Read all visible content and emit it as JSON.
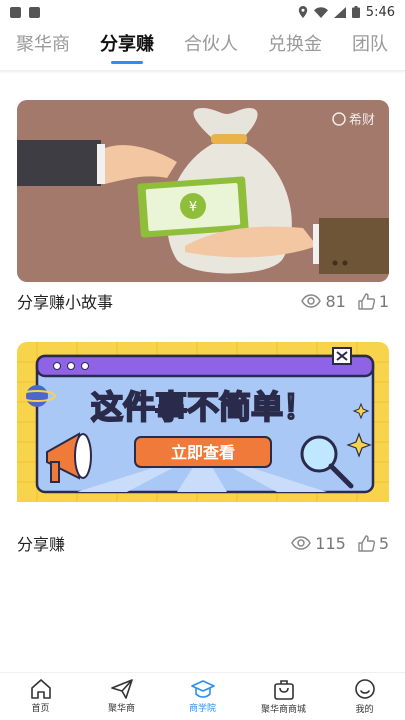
{
  "status_bar": {
    "time": "5:46"
  },
  "tabs": [
    {
      "label": "聚华商"
    },
    {
      "label": "分享赚"
    },
    {
      "label": "合伙人"
    },
    {
      "label": "兑换金"
    },
    {
      "label": "团队"
    }
  ],
  "active_tab": "分享赚",
  "cards": [
    {
      "title": "分享赚小故事",
      "views": "81",
      "likes": "1",
      "image_watermark": "希财"
    },
    {
      "title": "分享赚",
      "views": "115",
      "likes": "5",
      "banner_headline": "这件事不简单！",
      "banner_button": "立即查看"
    }
  ],
  "bottom_nav": [
    {
      "label": "首页",
      "icon": "home-icon"
    },
    {
      "label": "聚华商",
      "icon": "paper-plane-icon"
    },
    {
      "label": "商学院",
      "icon": "graduation-cap-icon"
    },
    {
      "label": "聚华商商城",
      "icon": "shopping-bag-icon"
    },
    {
      "label": "我的",
      "icon": "user-face-icon"
    }
  ],
  "colors": {
    "accent": "#2b8ff0",
    "card1_bg": "#a07a6c",
    "card2_bg": "#f7d64f",
    "banner_purple": "#8f63e6"
  }
}
